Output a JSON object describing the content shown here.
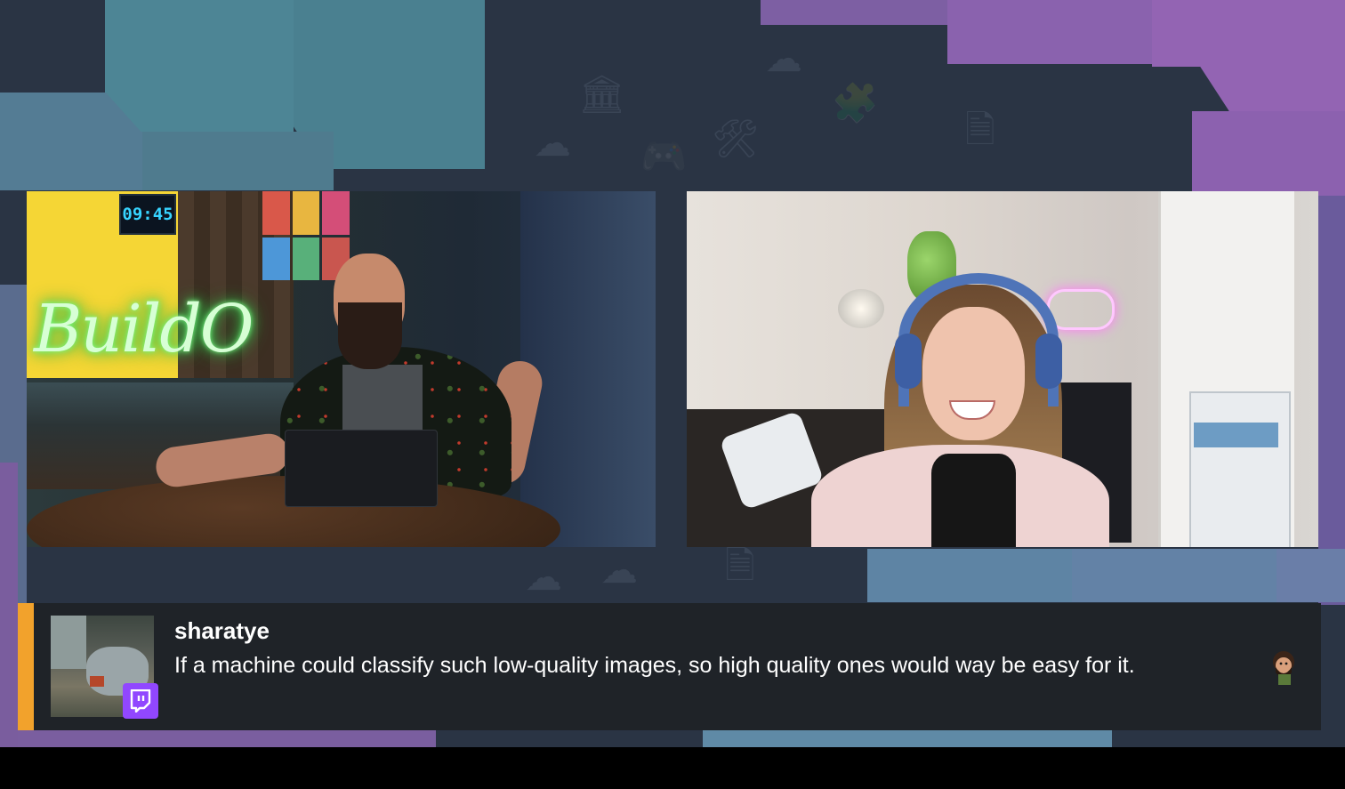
{
  "video_left": {
    "clock_text": "09:45",
    "neon_sign": "BuildO"
  },
  "chat": {
    "username": "sharatye",
    "message": "If a machine could classify such low-quality images, so high quality ones would way be easy for it.",
    "emote": "bearded-face-emote",
    "platform_icon": "twitch-icon",
    "accent_color": "#f2a22c",
    "badge_color": "#9147ff"
  },
  "theme": {
    "background": "#2a3444",
    "teal": "#4d8595",
    "purple": "#9364b3"
  }
}
